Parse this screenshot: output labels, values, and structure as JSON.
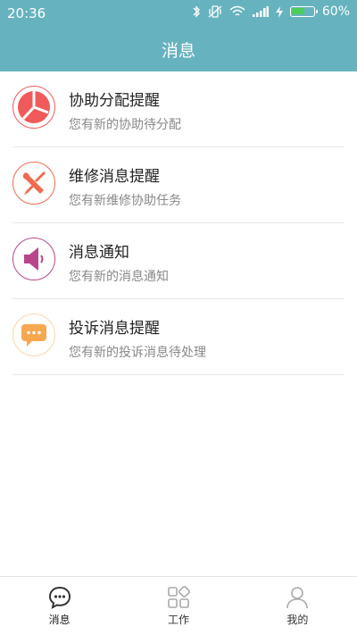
{
  "status_bar": {
    "time": "20:36",
    "battery_percent": "60%",
    "battery_level": 0.6,
    "battery_color": "#4ccc5a"
  },
  "header": {
    "title": "消息",
    "color": "#66b3bf"
  },
  "messages": [
    {
      "title": "协助分配提醒",
      "subtitle": "您有新的协助待分配",
      "icon": "pie-chart-icon",
      "color": "#f05a5a"
    },
    {
      "title": "维修消息提醒",
      "subtitle": "您有新维修协助任务",
      "icon": "tools-icon",
      "color": "#ef6b4f"
    },
    {
      "title": "消息通知",
      "subtitle": "您有新的消息通知",
      "icon": "speaker-icon",
      "color": "#b8468c"
    },
    {
      "title": "投诉消息提醒",
      "subtitle": "您有新的投诉消息待处理",
      "icon": "chat-bubble-icon",
      "color": "#f7a84e"
    }
  ],
  "bottom_nav": [
    {
      "label": "消息",
      "icon": "message-icon",
      "active": true
    },
    {
      "label": "工作",
      "icon": "grid-icon",
      "active": false
    },
    {
      "label": "我的",
      "icon": "user-icon",
      "active": false
    }
  ]
}
